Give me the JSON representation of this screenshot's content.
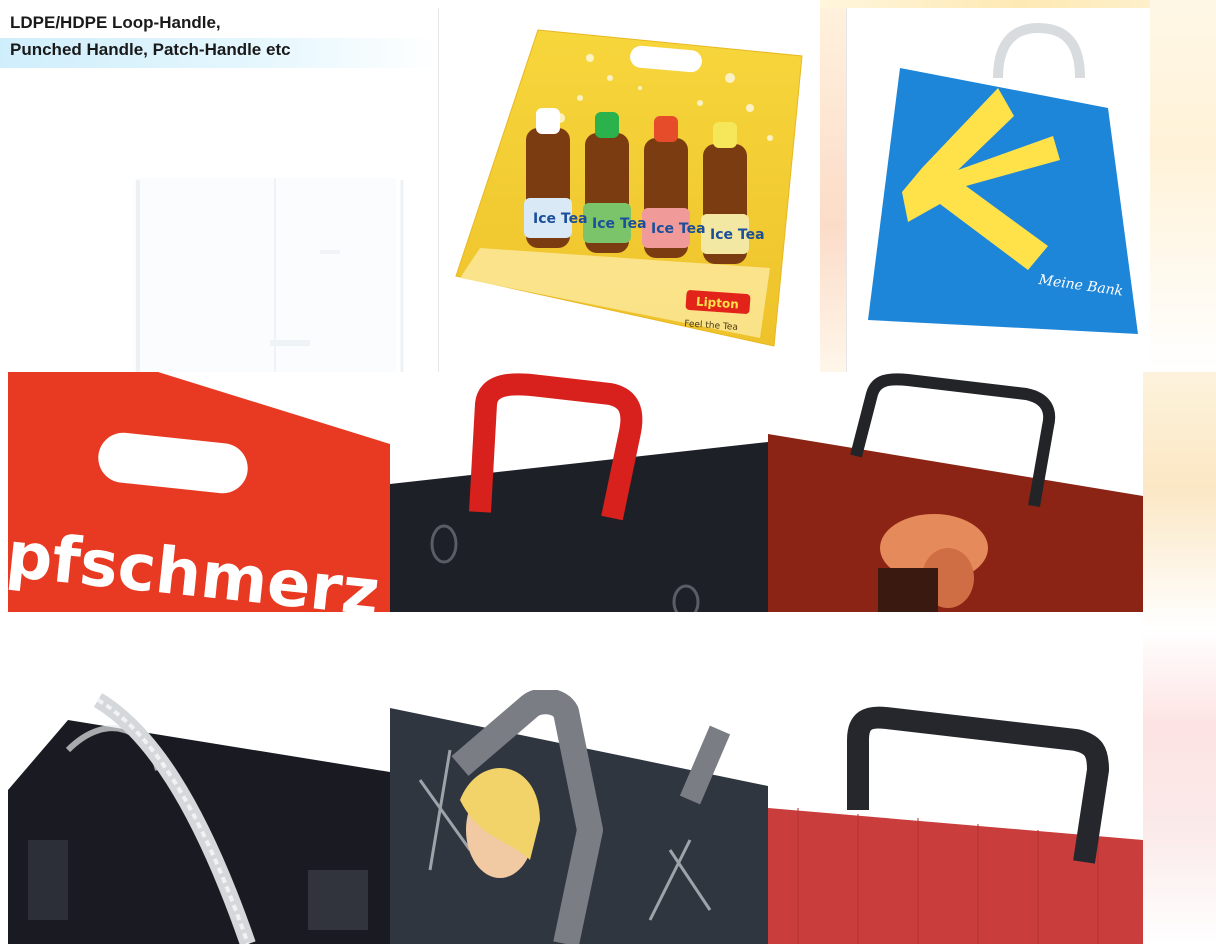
{
  "slide": {
    "title": "LDPE/HDPE Loop-Handle,\nPunched Handle, Patch-Handle etc"
  },
  "photos": {
    "lipton": {
      "brand": "Lipton",
      "product": "Ice Tea",
      "tagline": "Feel the Tea"
    },
    "bank": {
      "brand": "Meine Bank"
    },
    "punched": {
      "text": "pfschmerz"
    }
  },
  "colors": {
    "lipton_yellow": "#f3cf2e",
    "bank_blue": "#1e86d9",
    "bank_yellow": "#ffe14a",
    "punched_red": "#e83a22",
    "loop_red": "#d8211c",
    "bag_black": "#1e2027",
    "maroon": "#8b2414",
    "paper_red": "#c93d3c"
  }
}
